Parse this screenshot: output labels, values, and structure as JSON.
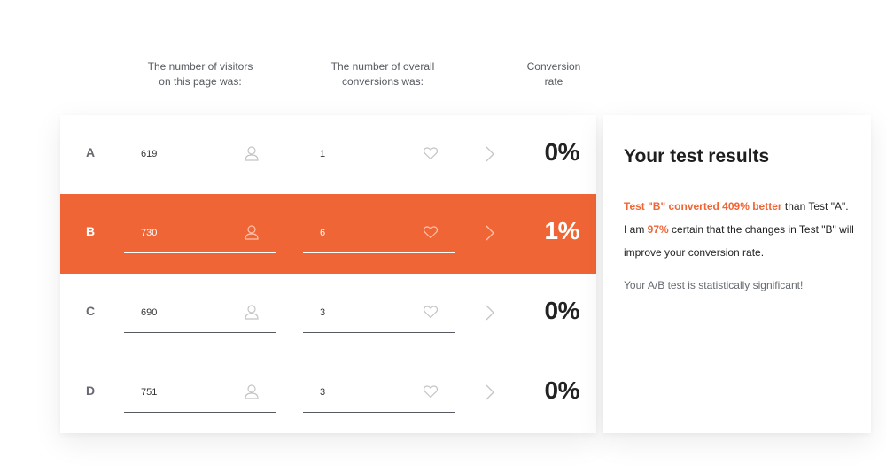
{
  "headers": {
    "visitors_line1": "The number of visitors",
    "visitors_line2": "on this page was:",
    "conversions_line1": "The number of overall",
    "conversions_line2": "conversions was:",
    "rate_line1": "Conversion",
    "rate_line2": "rate"
  },
  "rows": [
    {
      "label": "A",
      "visitors": "619",
      "conversions": "1",
      "rate": "0%"
    },
    {
      "label": "B",
      "visitors": "730",
      "conversions": "6",
      "rate": "1%"
    },
    {
      "label": "C",
      "visitors": "690",
      "conversions": "3",
      "rate": "0%"
    },
    {
      "label": "D",
      "visitors": "751",
      "conversions": "3",
      "rate": "0%"
    }
  ],
  "icons": {
    "visitors": "user-icon",
    "conversions": "heart-icon",
    "arrow": "chevron-right-icon"
  },
  "results": {
    "title": "Your test results",
    "line1_highlight": "Test \"B\" converted 409% better",
    "line1_rest": " than Test \"A\".",
    "line2_prefix": "I am ",
    "line2_highlight": "97%",
    "line2_rest": " certain that the changes in Test \"B\" will improve your conversion rate.",
    "significance": "Your A/B test is statistically significant!"
  },
  "colors": {
    "accent": "#f06535",
    "text_dark": "#222222",
    "text_muted": "#666a70",
    "icon_gray": "#c4c4c4"
  }
}
